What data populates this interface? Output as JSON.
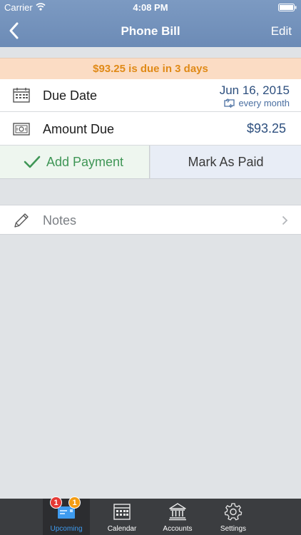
{
  "status_bar": {
    "carrier": "Carrier",
    "time": "4:08 PM"
  },
  "nav": {
    "title": "Phone Bill",
    "edit_label": "Edit"
  },
  "banner": {
    "text": "$93.25 is due in 3 days"
  },
  "due_date": {
    "label": "Due Date",
    "value": "Jun 16, 2015",
    "repeat": "every month"
  },
  "amount_due": {
    "label": "Amount Due",
    "value": "$93.25"
  },
  "actions": {
    "add_payment": "Add Payment",
    "mark_paid": "Mark As Paid"
  },
  "notes": {
    "label": "Notes"
  },
  "tabbar": {
    "items": [
      {
        "label": "Upcoming",
        "icon": "upcoming-bill-icon",
        "active": true
      },
      {
        "label": "Calendar",
        "icon": "calendar-icon"
      },
      {
        "label": "Accounts",
        "icon": "bank-icon"
      },
      {
        "label": "Settings",
        "icon": "gear-icon"
      }
    ],
    "badges": {
      "red": "1",
      "orange": "1"
    }
  },
  "colors": {
    "nav_bar": "#6c8bb6",
    "banner_bg": "#fbdcc4",
    "banner_text": "#e08a17",
    "value_text": "#2d4f7e",
    "add_payment_text": "#3f9656",
    "tab_active": "#3e9bef"
  }
}
